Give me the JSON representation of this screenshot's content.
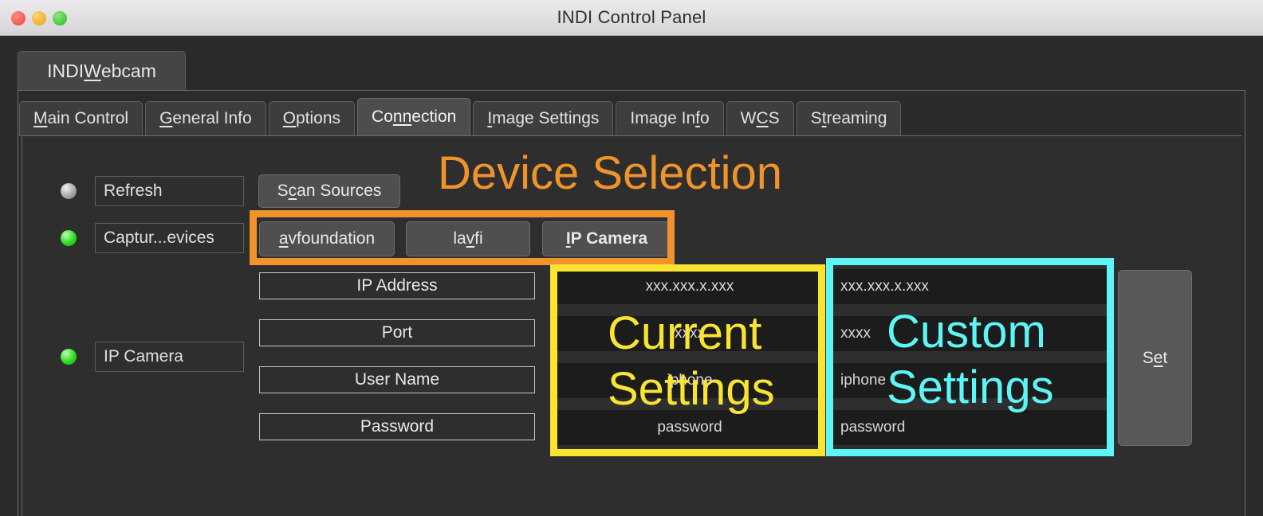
{
  "window": {
    "title": "INDI Control Panel",
    "traffic_lights": [
      "close-button",
      "minimize-button",
      "zoom-button"
    ]
  },
  "device_tab": {
    "label": "INDI Webcam",
    "mnemonic_index": 5
  },
  "tabs": [
    {
      "label": "Main Control",
      "active": false,
      "mnemonic_index": 0
    },
    {
      "label": "General Info",
      "active": false,
      "mnemonic_index": 0
    },
    {
      "label": "Options",
      "active": false,
      "mnemonic_index": 0
    },
    {
      "label": "Connection",
      "active": true,
      "mnemonic_index": 3
    },
    {
      "label": "Image Settings",
      "active": false,
      "mnemonic_index": 0
    },
    {
      "label": "Image Info",
      "active": false,
      "mnemonic_index": 7
    },
    {
      "label": "WCS",
      "active": false,
      "mnemonic_index": 1
    },
    {
      "label": "Streaming",
      "active": false,
      "mnemonic_index": 1
    }
  ],
  "properties": {
    "refresh": {
      "label": "Refresh",
      "state": "idle",
      "state_color": "#9a9a9a",
      "button": {
        "label": "Scan Sources",
        "mnemonic_index": 1
      }
    },
    "capture_devices": {
      "label": "Captur...evices",
      "state": "ok",
      "state_color": "#2fdb22",
      "options": [
        {
          "label": "avfoundation",
          "selected": false,
          "mnemonic_index": 0
        },
        {
          "label": "lavfi",
          "selected": false,
          "mnemonic_index": 3
        },
        {
          "label": "IP Camera",
          "selected": true,
          "mnemonic_index": 0
        }
      ]
    },
    "ip_camera": {
      "label": "IP Camera",
      "state": "ok",
      "state_color": "#2fdb22",
      "fields": [
        {
          "name": "IP Address",
          "current": "xxx.xxx.x.xxx",
          "custom": "xxx.xxx.x.xxx"
        },
        {
          "name": "Port",
          "current": "xxxx",
          "custom": "xxxx"
        },
        {
          "name": "User Name",
          "current": "iphone",
          "custom": "iphone"
        },
        {
          "name": "Password",
          "current": "password",
          "custom": "password"
        }
      ],
      "set_button": {
        "label": "Set",
        "mnemonic_index": 1
      }
    }
  },
  "annotations": [
    {
      "id": "device-selection",
      "text": "Device Selection",
      "color": "#f0932b"
    },
    {
      "id": "current-settings",
      "line1": "Current",
      "line2": "Settings",
      "color": "#f9e531"
    },
    {
      "id": "custom-settings",
      "line1": "Custom",
      "line2": "Settings",
      "color": "#5df5f5"
    }
  ]
}
